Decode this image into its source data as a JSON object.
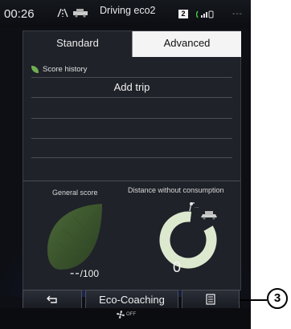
{
  "status": {
    "time": "00:26",
    "title": "Driving eco2",
    "badge": "2"
  },
  "tabs": [
    {
      "label": "Standard"
    },
    {
      "label": "Advanced"
    }
  ],
  "history": {
    "legend": "Score history",
    "add_trip": "Add trip"
  },
  "scores": {
    "general_label": "General score",
    "general_value_dashes": "--",
    "general_value_suffix": "/100",
    "distance_label": "Distance without consumption",
    "distance_value": "0"
  },
  "bottombar": {
    "center_label": "Eco-Coaching"
  },
  "climate": {
    "label": "OFF"
  },
  "callout": {
    "number": "3"
  },
  "colors": {
    "leaf_green": "#6fae52",
    "ring_green": "#dce9cf"
  },
  "icons": [
    "back-arrow-icon",
    "menu-icon",
    "fan-icon",
    "signal-icon",
    "road-icon",
    "car-icon"
  ]
}
